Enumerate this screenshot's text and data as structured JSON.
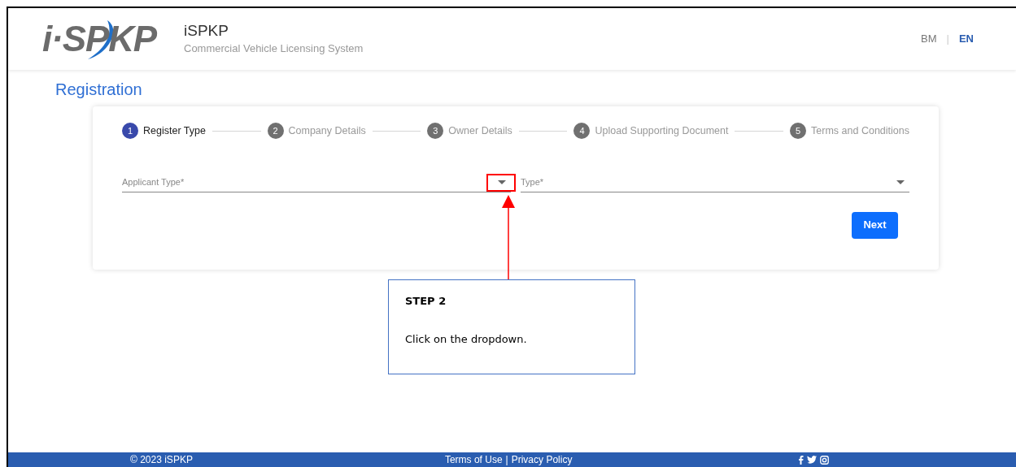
{
  "header": {
    "logo_text": "i·SPKP",
    "title": "iSPKP",
    "subtitle": "Commercial Vehicle Licensing System",
    "languages": [
      {
        "label": "BM",
        "selected": false
      },
      {
        "label": "EN",
        "selected": true
      }
    ],
    "separator": "|"
  },
  "page_title": "Registration",
  "steps": [
    {
      "number": "1",
      "label": "Register Type",
      "selected": true
    },
    {
      "number": "2",
      "label": "Company Details",
      "selected": false
    },
    {
      "number": "3",
      "label": "Owner Details",
      "selected": false
    },
    {
      "number": "4",
      "label": "Upload Supporting Document",
      "selected": false
    },
    {
      "number": "5",
      "label": "Terms and Conditions",
      "selected": false
    }
  ],
  "fields": [
    {
      "label": "Applicant Type*",
      "highlighted": true
    },
    {
      "label": "Type*",
      "highlighted": false
    }
  ],
  "next_button": "Next",
  "callout": {
    "title": "STEP 2",
    "text": "Click on the dropdown."
  },
  "footer": {
    "copyright": "© 2023 iSPKP",
    "links": [
      "Terms of Use",
      "Privacy Policy"
    ],
    "link_separator": "|"
  }
}
